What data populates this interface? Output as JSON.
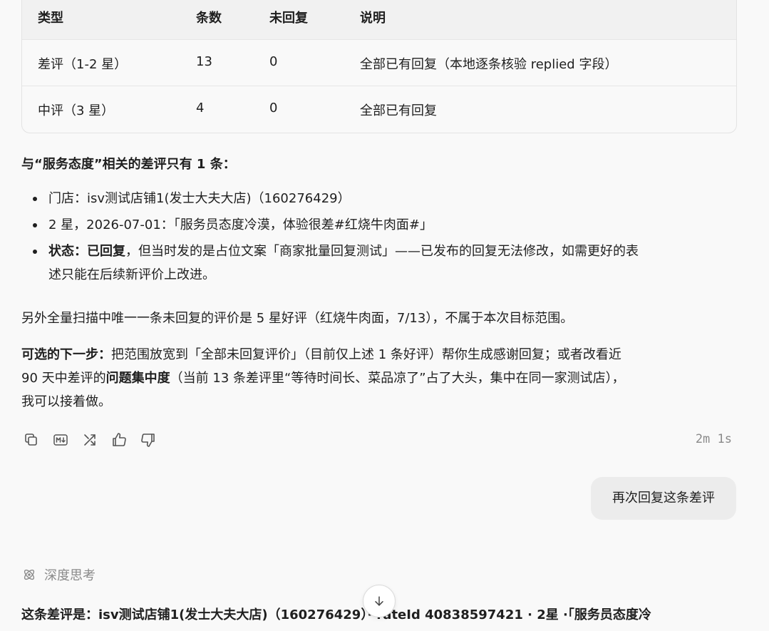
{
  "table": {
    "headers": [
      "类型",
      "条数",
      "未回复",
      "说明"
    ],
    "rows": [
      [
        "差评（1-2 星）",
        "13",
        "0",
        "全部已有回复（本地逐条核验 replied 字段）"
      ],
      [
        "中评（3 星）",
        "4",
        "0",
        "全部已有回复"
      ]
    ]
  },
  "summary": {
    "intro": "与“服务态度”相关的差评只有 1 条：",
    "bullets": {
      "store": "门店：isv测试店铺1(发士大夫大店)（160276429）",
      "rating": "2 星，2026-07-01：「服务员态度冷漠，体验很差#红烧牛肉面#」",
      "status_label": "状态：",
      "status_bold": "已回复",
      "status_line1": "，但当时发的是占位文案「商家批量回复测试」——已发布的回复无法修改，如需更好的表",
      "status_line2": "述只能在后续新评价上改进。"
    },
    "other": "另外全量扫描中唯一一条未回复的评价是 5 星好评（红烧牛肉面，7/13），不属于本次目标范围。",
    "next": {
      "label": "可选的下一步：",
      "line1": "把范围放宽到「全部未回复评价」（目前仅上述 1 条好评）帮你生成感谢回复；或者改看近",
      "line2_pre": "90 天中差评的",
      "line2_bold": "问题集中度",
      "line2_post": "（当前 13 条差评里“等待时间长、菜品凉了”占了大头，集中在同一家测试店），",
      "line3": "我可以接着做。"
    }
  },
  "actions": {
    "icons": [
      "copy-icon",
      "markdown-icon",
      "share-icon",
      "thumbs-up-icon",
      "thumbs-down-icon"
    ],
    "elapsed": "2m 1s"
  },
  "user_message": "再次回复这条差评",
  "thinking_label": "深度思考",
  "reply_preview": "这条差评是：isv测试店铺1(发士大夫大店)（160276429）· rateId 40838597421 · 2星 ·「服务员态度冷"
}
